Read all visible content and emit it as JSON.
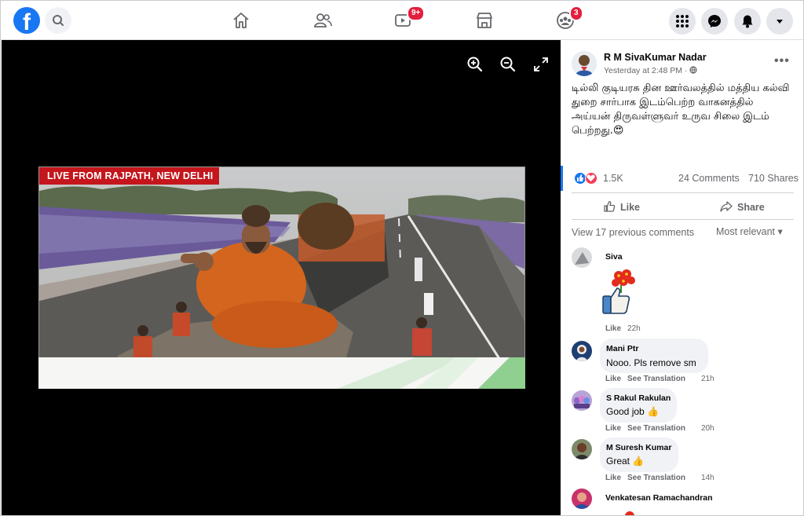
{
  "app": {
    "brand": "f",
    "accent": "#1877f2"
  },
  "nav": {
    "icons": [
      "home-icon",
      "friends-icon",
      "watch-icon",
      "marketplace-icon",
      "groups-icon"
    ],
    "watch_badge": "9+",
    "groups_badge": "3"
  },
  "media": {
    "banner": "LIVE FROM RAJPATH, NEW DELHI"
  },
  "post": {
    "author": "R M SivaKumar Nadar",
    "time": "Yesterday at 2:48 PM · ",
    "text": "டில்லி குடியரசு தின ஊர்வலத்தில் மத்திய கல்வி துறை சார்பாக இடம்பெற்ற வாகனத்தில் அய்யன் திருவள்ளுவர் உருவ சிலை இடம் பெற்றது.😍",
    "reactions": "1.5K",
    "comments": "24 Comments",
    "shares": "710 Shares",
    "like_label": "Like",
    "share_label": "Share",
    "previous_comments": "View 17 previous comments",
    "sort": "Most relevant ▾"
  },
  "comments": [
    {
      "name": "Siva",
      "text": "",
      "actions": [
        "Like"
      ],
      "time": "22h"
    },
    {
      "name": "Mani Ptr",
      "text": "Nooo. Pls remove sm",
      "actions": [
        "Like",
        "See Translation"
      ],
      "time": "21h"
    },
    {
      "name": "S Rakul Rakulan",
      "text": "Good job 👍",
      "actions": [
        "Like",
        "See Translation"
      ],
      "time": "20h"
    },
    {
      "name": "M Suresh Kumar",
      "text": "Great 👍",
      "actions": [
        "Like",
        "See Translation"
      ],
      "time": "14h"
    },
    {
      "name": "Venkatesan Ramachandran",
      "text": "",
      "actions": [],
      "time": ""
    }
  ]
}
